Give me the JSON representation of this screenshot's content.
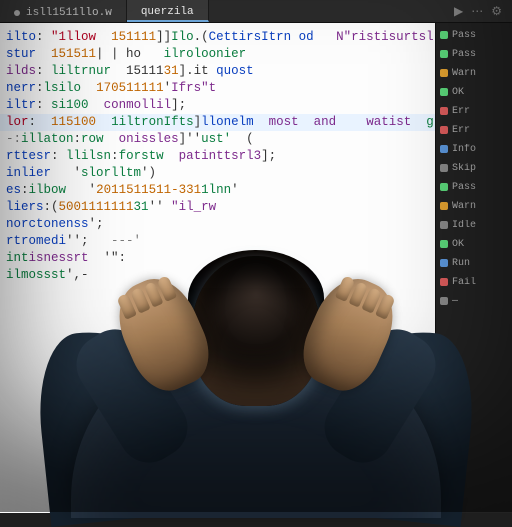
{
  "tabs": [
    {
      "label": "isll1511llo.w",
      "active": false
    },
    {
      "label": "querzila",
      "active": true
    }
  ],
  "code": {
    "lines": [
      {
        "cls": "",
        "tokens": [
          [
            "kw",
            "ilto"
          ],
          [
            "",
            ": "
          ],
          [
            "err",
            "\"1llow"
          ],
          [
            "",
            "  "
          ],
          [
            "num",
            "151111"
          ],
          [
            "",
            "]]"
          ],
          [
            "fn",
            "Ilo"
          ],
          [
            "",
            ".("
          ],
          [
            "kw",
            "CettirsItrn od"
          ],
          [
            "",
            "   "
          ],
          [
            "kw2",
            "N\"ristisurtslled"
          ],
          [
            ";"
          ]
        ]
      },
      {
        "cls": "",
        "tokens": [
          [
            "kw",
            "stur"
          ],
          [
            "",
            "  "
          ],
          [
            "num",
            "151511"
          ],
          [
            "",
            "| | ho   "
          ],
          [
            "fn",
            "ilroloonier"
          ]
        ]
      },
      {
        "cls": "",
        "tokens": [
          [
            "kw2",
            "ilds"
          ],
          [
            "",
            ": "
          ],
          [
            "fn",
            "liltrnur"
          ],
          [
            "",
            "  15111"
          ],
          [
            "num",
            "31"
          ],
          [
            "",
            "].it "
          ],
          [
            "kw",
            "quost"
          ],
          [
            " ("
          ]
        ]
      },
      {
        "cls": "",
        "tokens": [
          [
            "kw",
            "nerr"
          ],
          [
            "",
            ":"
          ],
          [
            "fn",
            "lsilo"
          ],
          [
            "",
            "  "
          ],
          [
            "num",
            "170511111"
          ],
          [
            "",
            "'"
          ],
          [
            "kw2",
            "Ifrs\"t"
          ],
          [
            ";"
          ]
        ]
      },
      {
        "cls": "",
        "tokens": [
          [
            "kw",
            "iltr"
          ],
          [
            "",
            ": "
          ],
          [
            "fn",
            "si100"
          ],
          [
            "",
            "  "
          ],
          [
            "kw2",
            "conmollil"
          ],
          [
            "",
            "];"
          ]
        ]
      },
      {
        "cls": "hl",
        "tokens": [
          [
            "err",
            "lor"
          ],
          [
            "",
            ":  "
          ],
          [
            "num",
            "115100"
          ],
          [
            "",
            "  "
          ],
          [
            "fn",
            "1iltronIfts"
          ],
          [
            "",
            "]"
          ],
          [
            "kw",
            "llonelm"
          ],
          [
            "",
            "  "
          ],
          [
            "kw2",
            "most"
          ],
          [
            "",
            "  "
          ],
          [
            "kw2",
            "and"
          ],
          [
            "",
            "    "
          ],
          [
            "kw2",
            "watist"
          ],
          [
            "",
            "  "
          ],
          [
            "fn",
            "grting"
          ],
          [
            "",
            "  '>"
          ]
        ]
      },
      {
        "cls": "",
        "tokens": [
          [
            "com",
            "-:"
          ],
          [
            "fn",
            "illaton"
          ],
          [
            "",
            ":"
          ],
          [
            "fn",
            "row"
          ],
          [
            "",
            "  "
          ],
          [
            "kw2",
            "onissles"
          ],
          [
            "",
            "]''"
          ],
          [
            " "
          ],
          [
            "fn",
            "ust'"
          ],
          [
            "",
            "  ("
          ]
        ]
      },
      {
        "cls": "",
        "tokens": [
          [
            "kw",
            "rttesr"
          ],
          [
            "",
            ": "
          ],
          [
            "fn",
            "llilsn"
          ],
          [
            "",
            ":"
          ],
          [
            "fn",
            "forstw"
          ],
          [
            "",
            "  "
          ],
          [
            "kw2",
            "patinttsrl3"
          ],
          [
            "",
            "];"
          ]
        ]
      },
      {
        "cls": "",
        "tokens": [
          [
            "kw",
            "inlier"
          ],
          [
            "",
            "   '"
          ],
          [
            "fn",
            "slorlltm"
          ],
          [
            "",
            "')"
          ]
        ]
      },
      {
        "cls": "",
        "tokens": [
          [
            "",
            ""
          ]
        ]
      },
      {
        "cls": "",
        "tokens": [
          [
            "kw",
            "es"
          ],
          [
            "",
            ":"
          ],
          [
            "fn",
            "ilbow"
          ],
          [
            "",
            "   '"
          ],
          [
            "num",
            "2011511511-331"
          ],
          [
            "fn",
            "1lnn"
          ],
          [
            "",
            "'"
          ]
        ]
      },
      {
        "cls": "",
        "tokens": [
          [
            "kw",
            "liers"
          ],
          [
            "",
            ":("
          ],
          [
            "num",
            "5001111111"
          ],
          [
            "fn",
            "31"
          ],
          [
            "",
            "'' "
          ],
          [
            "kw2",
            "\"il_rw"
          ]
        ]
      },
      {
        "cls": "",
        "tokens": [
          [
            "kw",
            "norctonenss"
          ],
          [
            "",
            "';"
          ]
        ]
      },
      {
        "cls": "",
        "tokens": [
          [
            "kw",
            "rtromedi"
          ],
          [
            "",
            "'';   "
          ],
          [
            "com",
            "---'"
          ]
        ]
      },
      {
        "cls": "",
        "tokens": [
          [
            "fn",
            "int"
          ],
          [
            "kw2",
            "isnessrt"
          ],
          [
            "",
            "  '\":"
          ]
        ]
      },
      {
        "cls": "",
        "tokens": [
          [
            "fn",
            "ilmossst"
          ],
          [
            "",
            "',-"
          ]
        ]
      }
    ]
  },
  "side": [
    {
      "c": "g",
      "t": "Pass"
    },
    {
      "c": "g",
      "t": "Pass"
    },
    {
      "c": "o",
      "t": "Warn"
    },
    {
      "c": "g",
      "t": "OK"
    },
    {
      "c": "r",
      "t": "Err"
    },
    {
      "c": "r",
      "t": "Err"
    },
    {
      "c": "b",
      "t": "Info"
    },
    {
      "c": "gr",
      "t": "Skip"
    },
    {
      "c": "g",
      "t": "Pass"
    },
    {
      "c": "o",
      "t": "Warn"
    },
    {
      "c": "gr",
      "t": "Idle"
    },
    {
      "c": "g",
      "t": "OK"
    },
    {
      "c": "b",
      "t": "Run"
    },
    {
      "c": "r",
      "t": "Fail"
    },
    {
      "c": "gr",
      "t": "—"
    }
  ],
  "header_icons": {
    "run": "▶",
    "more": "⋯",
    "settings": "⚙"
  }
}
